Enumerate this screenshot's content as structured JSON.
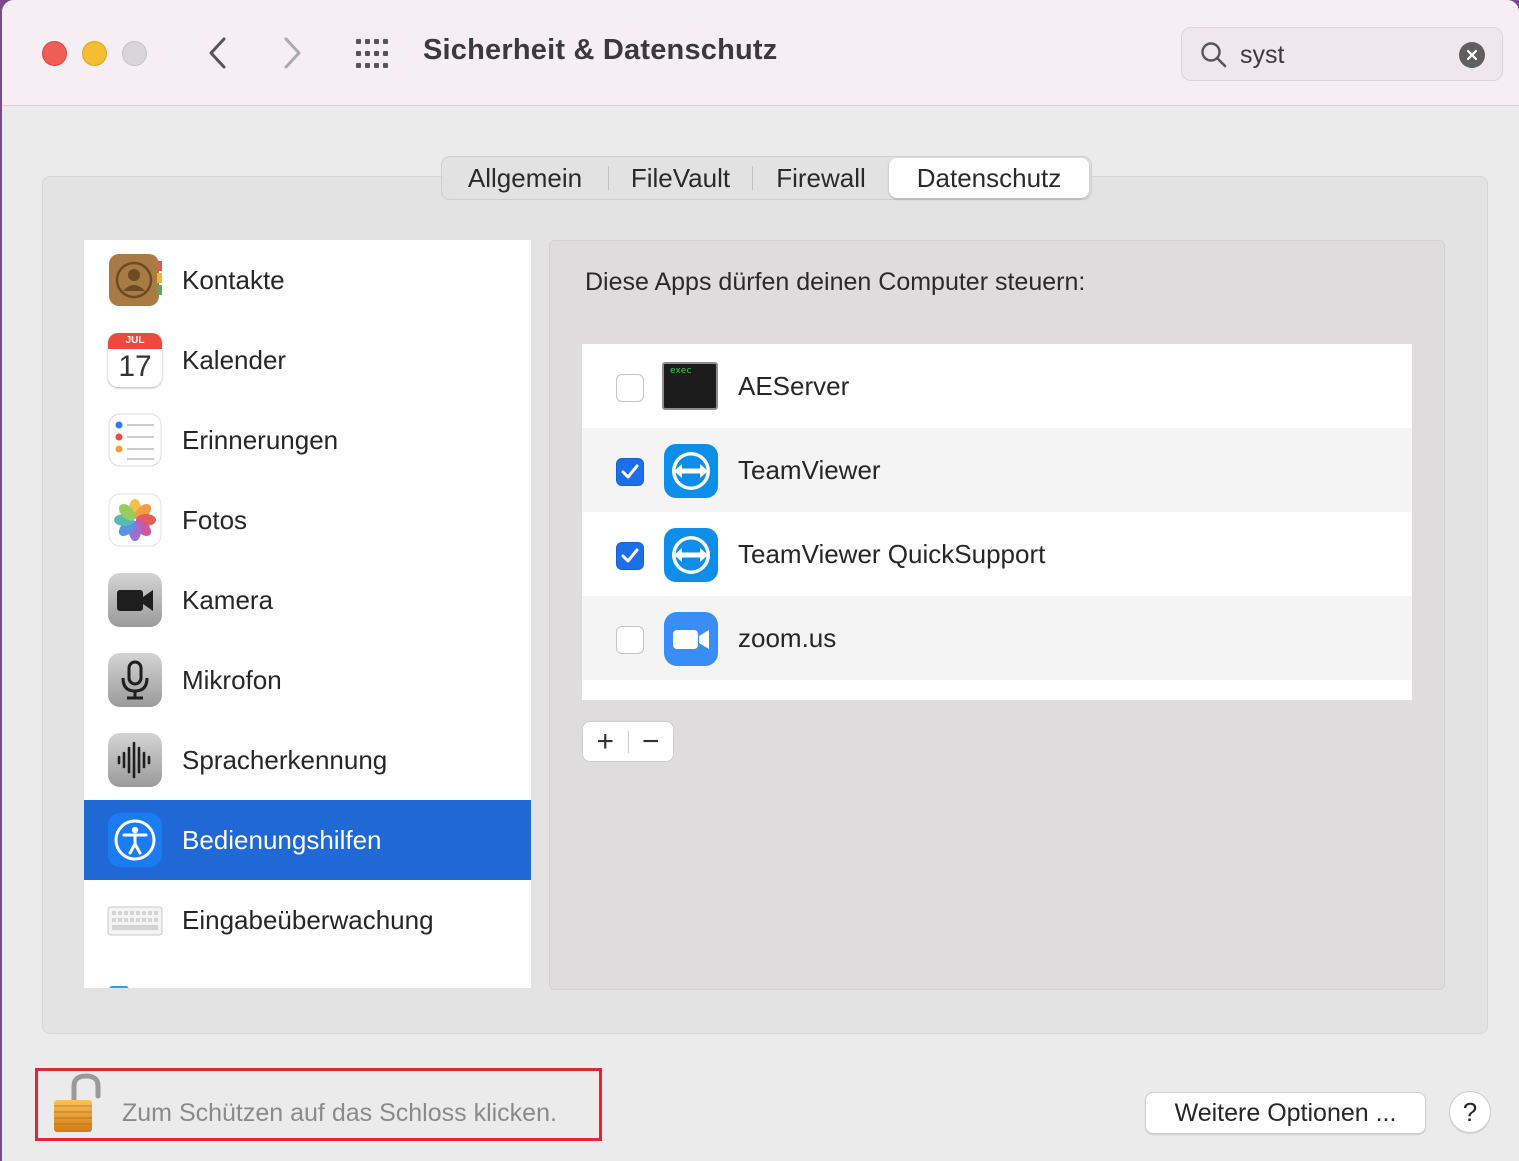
{
  "window": {
    "title": "Sicherheit & Datenschutz"
  },
  "search": {
    "value": "syst"
  },
  "tabs": [
    {
      "label": "Allgemein"
    },
    {
      "label": "FileVault"
    },
    {
      "label": "Firewall"
    },
    {
      "label": "Datenschutz",
      "active": true
    }
  ],
  "sidebar": {
    "items": [
      {
        "label": "Kontakte",
        "icon": "contacts-icon"
      },
      {
        "label": "Kalender",
        "icon": "calendar-icon",
        "month": "JUL",
        "day": "17"
      },
      {
        "label": "Erinnerungen",
        "icon": "reminders-icon"
      },
      {
        "label": "Fotos",
        "icon": "photos-icon"
      },
      {
        "label": "Kamera",
        "icon": "camera-icon"
      },
      {
        "label": "Mikrofon",
        "icon": "microphone-icon"
      },
      {
        "label": "Spracherkennung",
        "icon": "speech-recognition-icon"
      },
      {
        "label": "Bedienungshilfen",
        "icon": "accessibility-icon",
        "selected": true
      },
      {
        "label": "Eingabeüberwachung",
        "icon": "keyboard-icon"
      }
    ]
  },
  "panel": {
    "title": "Diese Apps dürfen deinen Computer steuern:",
    "apps": [
      {
        "name": "AEServer",
        "checked": false,
        "icon": "terminal-exec-icon",
        "icon_text": "exec"
      },
      {
        "name": "TeamViewer",
        "checked": true,
        "icon": "teamviewer-icon"
      },
      {
        "name": "TeamViewer QuickSupport",
        "checked": true,
        "icon": "teamviewer-icon"
      },
      {
        "name": "zoom.us",
        "checked": false,
        "icon": "zoom-icon"
      }
    ],
    "add_label": "+",
    "remove_label": "−"
  },
  "footer": {
    "lock_text": "Zum Schützen auf das Schloss klicken.",
    "more_button": "Weitere Optionen ...",
    "help_button": "?"
  },
  "colors": {
    "accent": "#1f68d5",
    "checkbox_checked": "#1c6fe6",
    "highlight_box": "#e02732"
  }
}
